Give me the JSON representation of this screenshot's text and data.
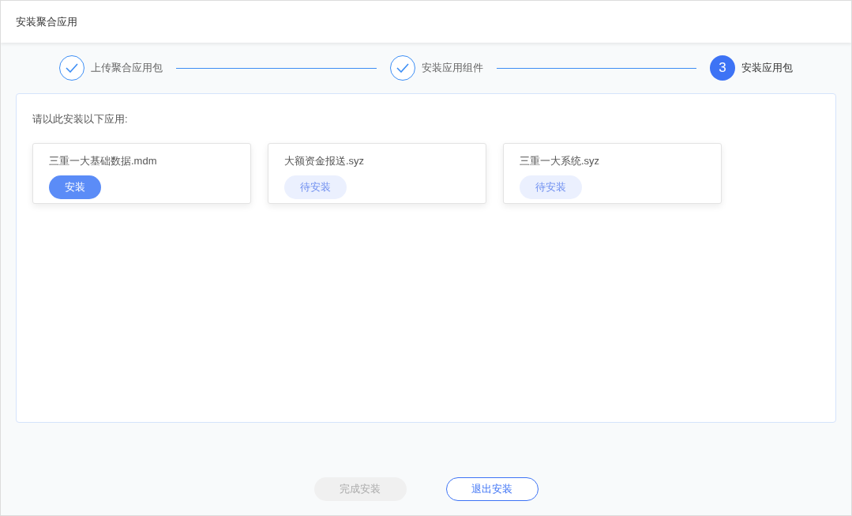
{
  "window": {
    "title": "安装聚合应用"
  },
  "steps": [
    {
      "kind": "done",
      "label": "上传聚合应用包"
    },
    {
      "kind": "done",
      "label": "安装应用组件"
    },
    {
      "kind": "current",
      "number": "3",
      "label": "安装应用包"
    }
  ],
  "panel": {
    "instruction": "请以此安装以下应用:",
    "apps": [
      {
        "name": "三重一大基础数据.mdm",
        "kind": "ready",
        "action": "安装"
      },
      {
        "name": "大额资金报送.syz",
        "kind": "pending",
        "action": "待安装"
      },
      {
        "name": "三重一大系统.syz",
        "kind": "pending",
        "action": "待安装"
      }
    ]
  },
  "footer_buttons": [
    {
      "label": "完成安装",
      "disabled": true
    },
    {
      "label": "退出安装",
      "disabled": false
    }
  ]
}
